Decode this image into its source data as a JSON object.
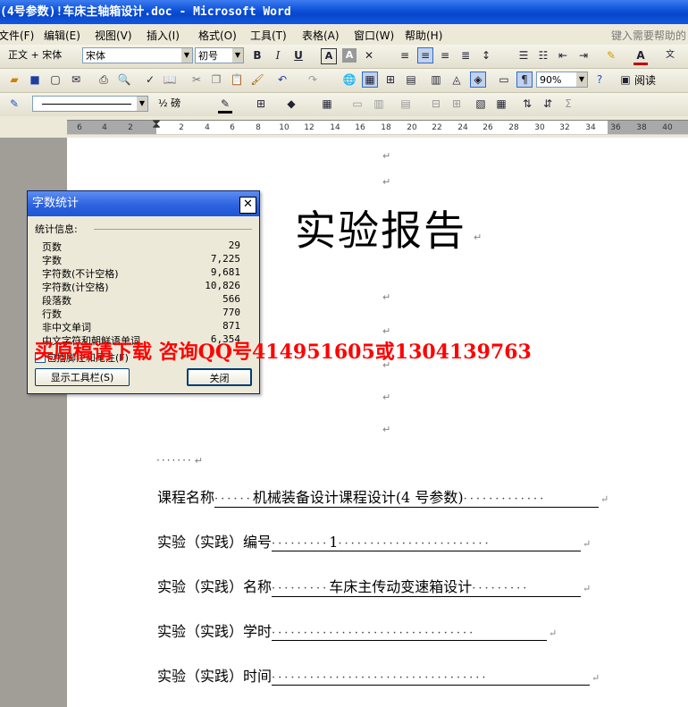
{
  "window": {
    "title": "(4号参数)!车床主轴箱设计.doc - Microsoft Word"
  },
  "menu": {
    "items": [
      "文件(F)",
      "编辑(E)",
      "视图(V)",
      "插入(I)",
      "格式(O)",
      "工具(T)",
      "表格(A)",
      "窗口(W)",
      "帮助(H)"
    ],
    "help_placeholder": "键入需要帮助的"
  },
  "format_toolbar": {
    "style": "正文 + 宋体",
    "font": "宋体",
    "size": "初号",
    "bold": "B",
    "italic": "I",
    "underline": "U",
    "char_border": "A",
    "char_shade": "A"
  },
  "standard_toolbar": {
    "zoom": "90%",
    "read_label": "阅读"
  },
  "drawing_toolbar": {
    "line_weight": "½ 磅"
  },
  "ruler": {
    "ticks": [
      "6",
      "4",
      "2",
      "2",
      "2",
      "4",
      "6",
      "8",
      "10",
      "12",
      "14",
      "16",
      "18",
      "20",
      "22",
      "24",
      "26",
      "28",
      "30",
      "32",
      "34",
      "36",
      "38",
      "40"
    ]
  },
  "document": {
    "paragraph_mark": "↵",
    "title": "实验报告",
    "dots_line": "·······",
    "fields": [
      {
        "label": "课程名称",
        "lead": "······",
        "value": "机械装备设计课程设计(4 号参数)",
        "trail": "·············"
      },
      {
        "label": "实验（实践）编号",
        "lead": "·········",
        "value": "1",
        "trail": "························"
      },
      {
        "label": "实验（实践）名称",
        "lead": "·········",
        "value": "车床主传动变速箱设计",
        "trail": "·········"
      },
      {
        "label": "实验（实践）学时",
        "lead": "",
        "value": "",
        "trail": "································"
      },
      {
        "label": "实验（实践）时间",
        "lead": "",
        "value": "",
        "trail": "··································"
      }
    ]
  },
  "word_count_dialog": {
    "title": "字数统计",
    "group_label": "统计信息:",
    "stats": [
      {
        "label": "页数",
        "value": "29"
      },
      {
        "label": "字数",
        "value": "7,225"
      },
      {
        "label": "字符数(不计空格)",
        "value": "9,681"
      },
      {
        "label": "字符数(计空格)",
        "value": "10,826"
      },
      {
        "label": "段落数",
        "value": "566"
      },
      {
        "label": "行数",
        "value": "770"
      },
      {
        "label": "非中文单词",
        "value": "871"
      },
      {
        "label": "中文字符和朝鲜语单词",
        "value": "6,354"
      }
    ],
    "checkbox_label": "包括脚注和尾注(F)",
    "show_toolbar_button": "显示工具栏(S)",
    "close_button": "关闭"
  },
  "watermark": "买原稿请下载  咨询QQ号414951605或1304139763",
  "colors": {
    "titlebar": "#0a4fd8",
    "watermark": "#ff0000",
    "dialog_bg": "#ece9d8"
  }
}
